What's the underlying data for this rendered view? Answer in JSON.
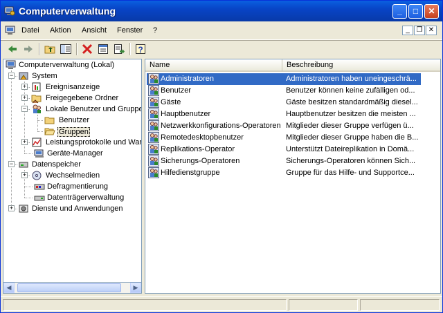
{
  "window": {
    "title": "Computerverwaltung"
  },
  "menubar": {
    "items": [
      "Datei",
      "Aktion",
      "Ansicht",
      "Fenster",
      "?"
    ]
  },
  "tree": {
    "items": [
      {
        "label": "Computerverwaltung (Lokal)"
      },
      {
        "label": "System"
      },
      {
        "label": "Ereignisanzeige"
      },
      {
        "label": "Freigegebene Ordner"
      },
      {
        "label": "Lokale Benutzer und Gruppen"
      },
      {
        "label": "Benutzer"
      },
      {
        "label": "Gruppen"
      },
      {
        "label": "Leistungsprotokolle und Warnungen"
      },
      {
        "label": "Geräte-Manager"
      },
      {
        "label": "Datenspeicher"
      },
      {
        "label": "Wechselmedien"
      },
      {
        "label": "Defragmentierung"
      },
      {
        "label": "Datenträgerverwaltung"
      },
      {
        "label": "Dienste und Anwendungen"
      }
    ]
  },
  "list": {
    "columns": [
      "Name",
      "Beschreibung"
    ],
    "rows": [
      {
        "name": "Administratoren",
        "desc": "Administratoren haben uneingeschrä..."
      },
      {
        "name": "Benutzer",
        "desc": "Benutzer können keine zufälligen od..."
      },
      {
        "name": "Gäste",
        "desc": "Gäste besitzen standardmäßig diesel..."
      },
      {
        "name": "Hauptbenutzer",
        "desc": "Hauptbenutzer besitzen die meisten ..."
      },
      {
        "name": "Netzwerkkonfigurations-Operatoren",
        "desc": "Mitglieder dieser Gruppe verfügen ü..."
      },
      {
        "name": "Remotedesktopbenutzer",
        "desc": "Mitglieder dieser Gruppe haben die B..."
      },
      {
        "name": "Replikations-Operator",
        "desc": "Unterstützt Dateireplikation in Domä..."
      },
      {
        "name": "Sicherungs-Operatoren",
        "desc": "Sicherungs-Operatoren können Sich..."
      },
      {
        "name": "Hilfedienstgruppe",
        "desc": "Gruppe für das Hilfe- und Supportce..."
      }
    ]
  },
  "icons": {
    "back": "back-arrow-icon",
    "forward": "forward-arrow-icon",
    "up": "up-folder-icon",
    "tree_toggle": "show-tree-icon",
    "delete": "delete-icon",
    "properties": "properties-icon",
    "export": "export-list-icon",
    "help": "help-icon",
    "group": "group-icon"
  },
  "colors": {
    "title_bar": "#0844c6",
    "selection": "#316ac5",
    "chrome": "#ece9d8"
  }
}
